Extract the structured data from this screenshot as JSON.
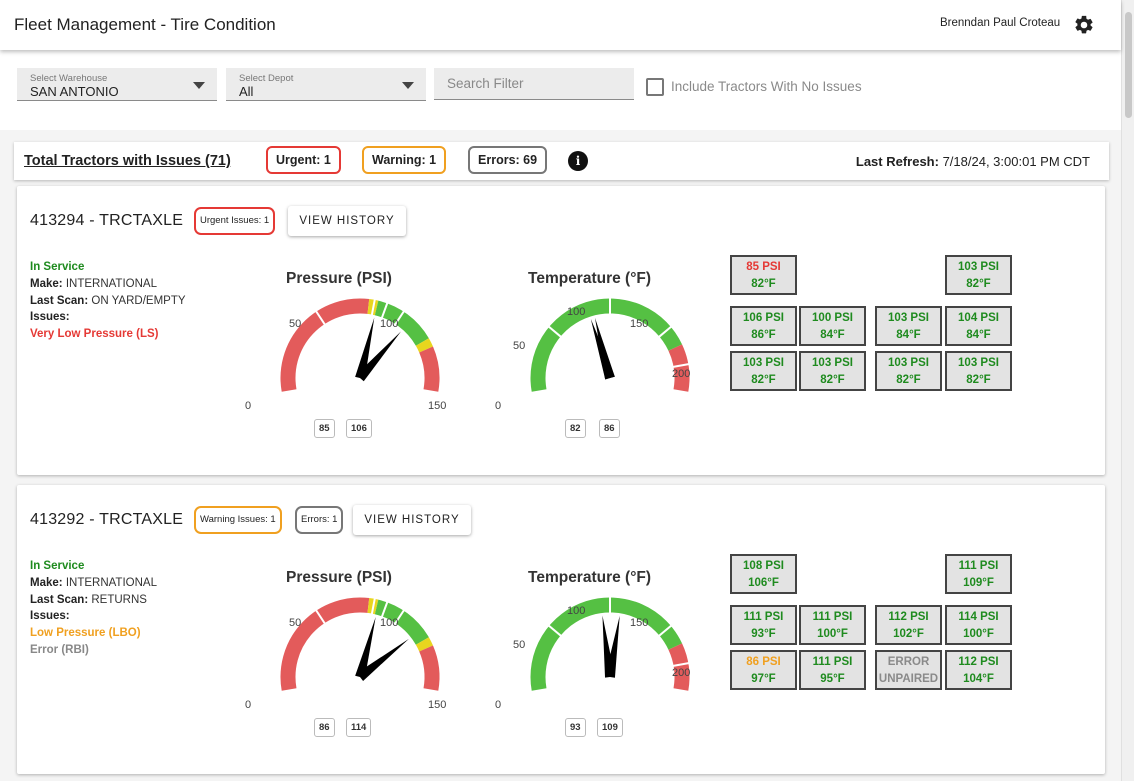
{
  "app": {
    "title": "Fleet Management - Tire Condition",
    "user": "Brenndan Paul Croteau"
  },
  "filters": {
    "warehouse_label": "Select Warehouse",
    "warehouse_value": "SAN ANTONIO",
    "depot_label": "Select Depot",
    "depot_value": "All",
    "search_placeholder": "Search Filter",
    "include_label": "Include Tractors With No Issues",
    "include_checked": false
  },
  "summary": {
    "total": "Total Tractors with Issues (71)",
    "urgent": "Urgent: 1",
    "warning": "Warning: 1",
    "errors": "Errors: 69",
    "last_refresh_label": "Last Refresh:",
    "last_refresh_value": "7/18/24, 3:00:01 PM CDT",
    "colors": {
      "urgent": "#e53935",
      "warning": "#f0a020",
      "errors": "#777777",
      "ok": "#1f8b1f",
      "green_arc": "#55c043",
      "red_arc": "#e35b5b",
      "yellow_arc": "#e8d61e"
    }
  },
  "tractors": [
    {
      "title": "413294 - TRCTAXLE",
      "badges": [
        {
          "text": "Urgent Issues: 1",
          "color": "#e53935"
        }
      ],
      "history_label": "VIEW HISTORY",
      "status": "In Service",
      "make_label": "Make:",
      "make": "INTERNATIONAL",
      "scan_label": "Last Scan:",
      "scan": "ON YARD/EMPTY",
      "issues_label": "Issues:",
      "issues": [
        {
          "text": "Very Low Pressure (LS)",
          "level": "urgent"
        }
      ],
      "pressure": {
        "title": "Pressure (PSI)",
        "ticks": [
          "0",
          "50",
          "100",
          "150"
        ],
        "needles": [
          85,
          106
        ],
        "labels": [
          "85",
          "106"
        ]
      },
      "temperature": {
        "title": "Temperature (°F)",
        "ticks": [
          "0",
          "50",
          "100",
          "150",
          "200"
        ],
        "needles": [
          82,
          86
        ],
        "labels": [
          "82",
          "86"
        ]
      },
      "tires": [
        {
          "psi": "85 PSI",
          "temp": "82°F",
          "psi_level": "r",
          "temp_level": "g"
        },
        {
          "psi": "103 PSI",
          "temp": "82°F",
          "psi_level": "g",
          "temp_level": "g"
        },
        {
          "psi": "106 PSI",
          "temp": "86°F",
          "psi_level": "g",
          "temp_level": "g"
        },
        {
          "psi": "100 PSI",
          "temp": "84°F",
          "psi_level": "g",
          "temp_level": "g"
        },
        {
          "psi": "103 PSI",
          "temp": "84°F",
          "psi_level": "g",
          "temp_level": "g"
        },
        {
          "psi": "104 PSI",
          "temp": "84°F",
          "psi_level": "g",
          "temp_level": "g"
        },
        {
          "psi": "103 PSI",
          "temp": "82°F",
          "psi_level": "g",
          "temp_level": "g"
        },
        {
          "psi": "103 PSI",
          "temp": "82°F",
          "psi_level": "g",
          "temp_level": "g"
        },
        {
          "psi": "103 PSI",
          "temp": "82°F",
          "psi_level": "g",
          "temp_level": "g"
        },
        {
          "psi": "103 PSI",
          "temp": "82°F",
          "psi_level": "g",
          "temp_level": "g"
        }
      ]
    },
    {
      "title": "413292 - TRCTAXLE",
      "badges": [
        {
          "text": "Warning Issues: 1",
          "color": "#f0a020"
        },
        {
          "text": "Errors: 1",
          "color": "#777777"
        }
      ],
      "history_label": "VIEW HISTORY",
      "status": "In Service",
      "make_label": "Make:",
      "make": "INTERNATIONAL",
      "scan_label": "Last Scan:",
      "scan": "RETURNS",
      "issues_label": "Issues:",
      "issues": [
        {
          "text": "Low Pressure (LBO)",
          "level": "warn"
        },
        {
          "text": "Error (RBI)",
          "level": "err"
        }
      ],
      "pressure": {
        "title": "Pressure (PSI)",
        "ticks": [
          "0",
          "50",
          "100",
          "150"
        ],
        "needles": [
          86,
          114
        ],
        "labels": [
          "86",
          "114"
        ]
      },
      "temperature": {
        "title": "Temperature (°F)",
        "ticks": [
          "0",
          "50",
          "100",
          "150",
          "200"
        ],
        "needles": [
          93,
          109
        ],
        "labels": [
          "93",
          "109"
        ]
      },
      "tires": [
        {
          "psi": "108 PSI",
          "temp": "106°F",
          "psi_level": "g",
          "temp_level": "g"
        },
        {
          "psi": "111 PSI",
          "temp": "109°F",
          "psi_level": "g",
          "temp_level": "g"
        },
        {
          "psi": "111 PSI",
          "temp": "93°F",
          "psi_level": "g",
          "temp_level": "g"
        },
        {
          "psi": "111 PSI",
          "temp": "100°F",
          "psi_level": "g",
          "temp_level": "g"
        },
        {
          "psi": "112 PSI",
          "temp": "102°F",
          "psi_level": "g",
          "temp_level": "g"
        },
        {
          "psi": "114 PSI",
          "temp": "100°F",
          "psi_level": "g",
          "temp_level": "g"
        },
        {
          "psi": "86 PSI",
          "temp": "97°F",
          "psi_level": "o",
          "temp_level": "g"
        },
        {
          "psi": "111 PSI",
          "temp": "95°F",
          "psi_level": "g",
          "temp_level": "g"
        },
        {
          "psi": "ERROR",
          "temp": "UNPAIRED",
          "psi_level": "e",
          "temp_level": "e"
        },
        {
          "psi": "112 PSI",
          "temp": "104°F",
          "psi_level": "g",
          "temp_level": "g"
        }
      ]
    }
  ]
}
